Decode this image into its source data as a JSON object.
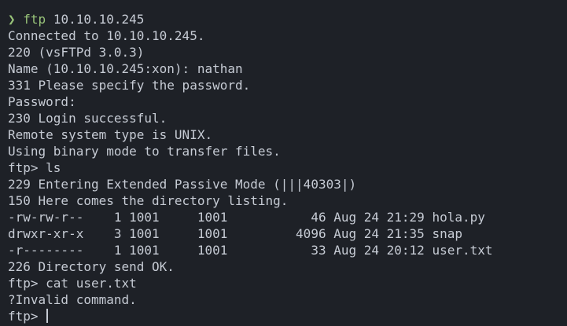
{
  "terminal": {
    "shell_prompt": {
      "glyph": "❯",
      "command": "ftp",
      "args": " 10.10.10.245"
    },
    "lines": [
      "Connected to 10.10.10.245.",
      "220 (vsFTPd 3.0.3)",
      "Name (10.10.10.245:xon): nathan",
      "331 Please specify the password.",
      "Password:",
      "230 Login successful.",
      "Remote system type is UNIX.",
      "Using binary mode to transfer files.",
      "ftp> ls",
      "229 Entering Extended Passive Mode (|||40303|)",
      "150 Here comes the directory listing.",
      "-rw-rw-r--    1 1001     1001           46 Aug 24 21:29 hola.py",
      "drwxr-xr-x    3 1001     1001         4096 Aug 24 21:35 snap",
      "-r--------    1 1001     1001           33 Aug 24 20:12 user.txt",
      "226 Directory send OK.",
      "ftp> cat user.txt",
      "?Invalid command."
    ],
    "active_prompt": "ftp> ",
    "colors": {
      "background": "#1e2127",
      "foreground": "#c6cbd4",
      "accent_green": "#98c379"
    }
  }
}
